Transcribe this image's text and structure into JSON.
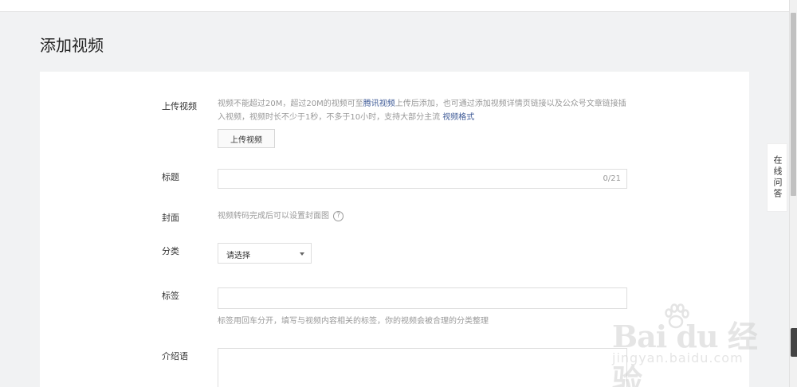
{
  "page": {
    "title": "添加视频"
  },
  "form": {
    "upload": {
      "label": "上传视频",
      "hint_part1": "视频不能超过20M，超过20M的视频可至",
      "hint_link1": "腾讯视频",
      "hint_part2": "上传后添加，也可通过添加视频详情页链接以及公众号文章链接插",
      "hint_part3": "入视频，视频时长不少于1秒，不多于10小时，支持大部分主流",
      "hint_link2": "视频格式",
      "button": "上传视频"
    },
    "title": {
      "label": "标题",
      "value": "",
      "counter": "0/21"
    },
    "cover": {
      "label": "封面",
      "hint": "视频转码完成后可以设置封面图",
      "help": "?"
    },
    "category": {
      "label": "分类",
      "selected": "请选择"
    },
    "tags": {
      "label": "标签",
      "value": "",
      "hint": "标签用回车分开，填写与视频内容相关的标签，你的视频会被合理的分类整理"
    },
    "intro": {
      "label": "介绍语",
      "value": ""
    }
  },
  "side": {
    "qa_label": "在线问答"
  },
  "watermark": {
    "text": "Bai du 经验",
    "sub": "jingyan.baidu.com"
  }
}
